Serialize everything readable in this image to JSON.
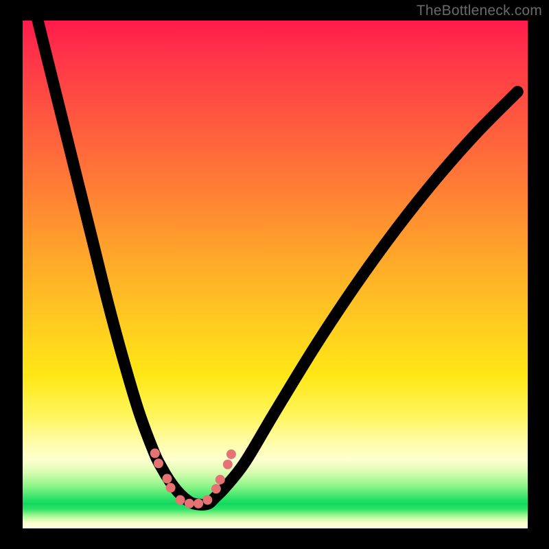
{
  "watermark": "TheBottleneck.com",
  "chart_data": {
    "type": "line",
    "title": "",
    "xlabel": "",
    "ylabel": "",
    "xlim": [
      0,
      100
    ],
    "ylim": [
      0,
      100
    ],
    "grid": false,
    "legend": false,
    "curve_note": "Piecewise V-shaped curve drawn over a red-to-green vertical gradient. Values are y-percent-from-top at each x-percent, estimated from pixels.",
    "series": [
      {
        "name": "curve",
        "x": [
          2,
          5,
          8,
          11,
          14,
          17,
          20,
          23,
          26,
          27.5,
          29,
          30.5,
          32,
          33.5,
          35,
          36,
          37,
          38,
          40,
          44,
          50,
          58,
          66,
          74,
          82,
          90,
          98
        ],
        "y": [
          -4,
          8,
          20,
          32,
          44,
          56,
          67,
          77,
          85,
          88,
          90.5,
          92.5,
          94,
          95,
          95.3,
          95.3,
          95,
          94,
          92,
          87,
          77,
          64,
          52,
          41,
          31,
          22,
          14
        ]
      }
    ],
    "dots": {
      "name": "highlight-dots",
      "color": "#e57373",
      "radius_pct": 0.95,
      "points": [
        {
          "x": 26.2,
          "y": 85.2
        },
        {
          "x": 26.9,
          "y": 87.2
        },
        {
          "x": 28.6,
          "y": 90.2
        },
        {
          "x": 29.3,
          "y": 92.0
        },
        {
          "x": 31.2,
          "y": 94.4
        },
        {
          "x": 33.0,
          "y": 95.1
        },
        {
          "x": 34.8,
          "y": 95.1
        },
        {
          "x": 36.6,
          "y": 94.4
        },
        {
          "x": 38.3,
          "y": 92.2
        },
        {
          "x": 39.1,
          "y": 90.4
        },
        {
          "x": 40.6,
          "y": 87.4
        },
        {
          "x": 41.3,
          "y": 85.4
        }
      ]
    },
    "gradient_colors": {
      "top": "#ff1a4b",
      "mid_upper": "#ffa22b",
      "mid": "#ffe716",
      "band_green": "#0fd85e",
      "bottom": "#fffde0"
    }
  }
}
